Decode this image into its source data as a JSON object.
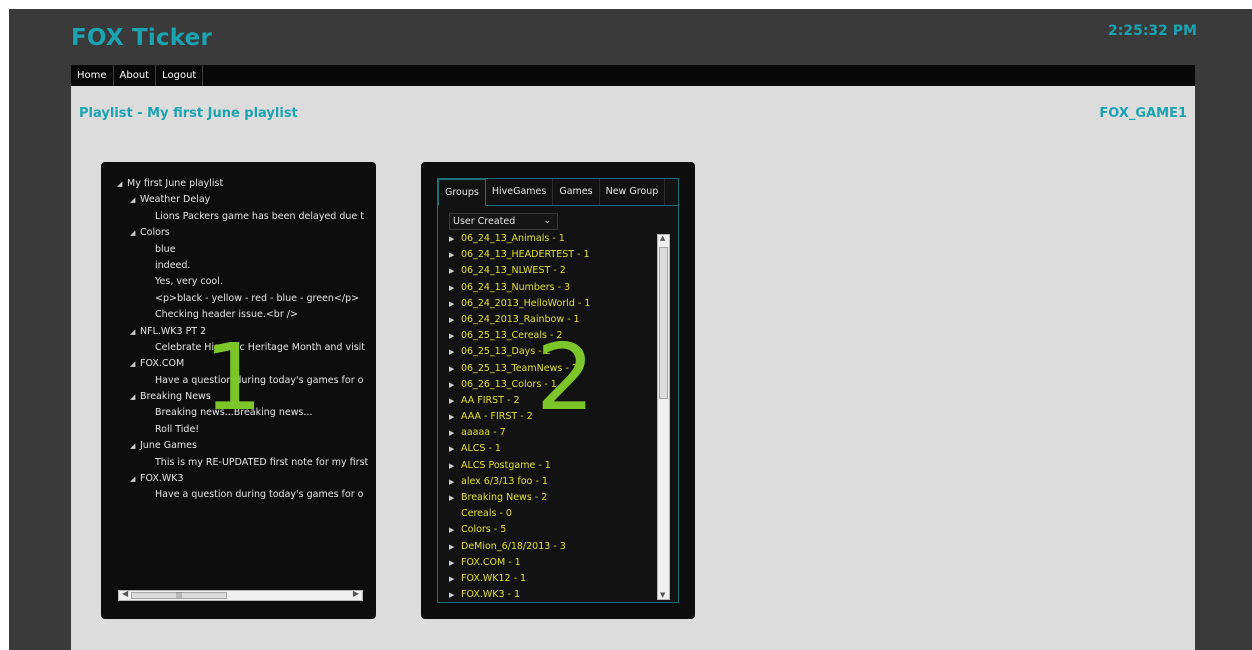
{
  "app": {
    "title": "FOX Ticker",
    "clock": "2:25:32 PM"
  },
  "nav": [
    "Home",
    "About",
    "Logout"
  ],
  "page": {
    "heading": "Playlist - My first June playlist",
    "game_id": "FOX_GAME1"
  },
  "playlist_tree": [
    {
      "level": 0,
      "arrow": true,
      "text": "My first June playlist"
    },
    {
      "level": 1,
      "arrow": true,
      "text": "Weather Delay"
    },
    {
      "level": 2,
      "arrow": false,
      "text": "Lions Packers game has been delayed due t"
    },
    {
      "level": 1,
      "arrow": true,
      "text": "Colors"
    },
    {
      "level": 2,
      "arrow": false,
      "text": "blue"
    },
    {
      "level": 2,
      "arrow": false,
      "text": "indeed."
    },
    {
      "level": 2,
      "arrow": false,
      "text": "Yes, very cool."
    },
    {
      "level": 2,
      "arrow": false,
      "text": "<p>black - yellow - red - blue - green</p>"
    },
    {
      "level": 2,
      "arrow": false,
      "text": "Checking header issue.<br />"
    },
    {
      "level": 1,
      "arrow": true,
      "text": "NFL.WK3 PT 2"
    },
    {
      "level": 2,
      "arrow": false,
      "text": "Celebrate Hispanic Heritage Month and visit"
    },
    {
      "level": 1,
      "arrow": true,
      "text": "FOX.COM"
    },
    {
      "level": 2,
      "arrow": false,
      "text": "Have a question during today's games for o"
    },
    {
      "level": 1,
      "arrow": true,
      "text": "Breaking News"
    },
    {
      "level": 2,
      "arrow": false,
      "text": "Breaking news...Breaking news..."
    },
    {
      "level": 2,
      "arrow": false,
      "text": "Roll Tide!"
    },
    {
      "level": 1,
      "arrow": true,
      "text": "June Games"
    },
    {
      "level": 2,
      "arrow": false,
      "text": "This is my RE-UPDATED first note for my first"
    },
    {
      "level": 1,
      "arrow": true,
      "text": "FOX.WK3"
    },
    {
      "level": 2,
      "arrow": false,
      "text": "Have a question during today's games for o"
    }
  ],
  "panel_labels": {
    "left": "1",
    "right": "2"
  },
  "tabs": [
    "Groups",
    "HiveGames",
    "Games",
    "New Group"
  ],
  "group_filter": {
    "selected": "User Created"
  },
  "groups": [
    {
      "label": "06_24_13_Animals - 1",
      "arrow": true
    },
    {
      "label": "06_24_13_HEADERTEST - 1",
      "arrow": true
    },
    {
      "label": "06_24_13_NLWEST - 2",
      "arrow": true
    },
    {
      "label": "06_24_13_Numbers - 3",
      "arrow": true
    },
    {
      "label": "06_24_2013_HelloWorld - 1",
      "arrow": true
    },
    {
      "label": "06_24_2013_Rainbow - 1",
      "arrow": true
    },
    {
      "label": "06_25_13_Cereals - 2",
      "arrow": true
    },
    {
      "label": "06_25_13_Days - 2",
      "arrow": true
    },
    {
      "label": "06_25_13_TeamNews - 2",
      "arrow": true
    },
    {
      "label": "06_26_13_Colors - 1",
      "arrow": true
    },
    {
      "label": "AA FIRST - 2",
      "arrow": true
    },
    {
      "label": "AAA - FIRST - 2",
      "arrow": true
    },
    {
      "label": "aaaaa - 7",
      "arrow": true
    },
    {
      "label": "ALCS - 1",
      "arrow": true
    },
    {
      "label": "ALCS Postgame - 1",
      "arrow": true
    },
    {
      "label": "alex 6/3/13 foo - 1",
      "arrow": true
    },
    {
      "label": "Breaking News - 2",
      "arrow": true
    },
    {
      "label": "Cereals - 0",
      "arrow": false
    },
    {
      "label": "Colors - 5",
      "arrow": true
    },
    {
      "label": "DeMion_6/18/2013 - 3",
      "arrow": true
    },
    {
      "label": "FOX.COM - 1",
      "arrow": true
    },
    {
      "label": "FOX.WK12 - 1",
      "arrow": true
    },
    {
      "label": "FOX.WK3 - 1",
      "arrow": true
    }
  ]
}
